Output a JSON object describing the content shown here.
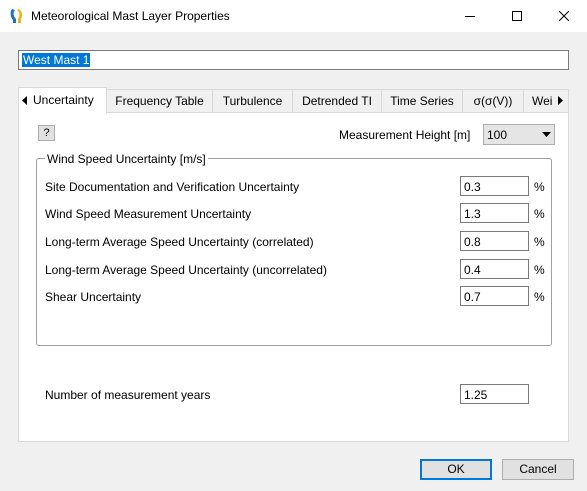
{
  "window": {
    "title": "Meteorological Mast Layer Properties",
    "icon": "wind-turbine-app-icon"
  },
  "name_field": {
    "value": "West Mast 1",
    "selected": true
  },
  "tabs": [
    {
      "label": "Uncertainty",
      "active": true
    },
    {
      "label": "Frequency Table"
    },
    {
      "label": "Turbulence"
    },
    {
      "label": "Detrended TI"
    },
    {
      "label": "Time Series"
    },
    {
      "label": "σ(σ(V))"
    },
    {
      "label": "Wei"
    }
  ],
  "uncertainty": {
    "help_label": "?",
    "measurement_height": {
      "label": "Measurement Height [m]",
      "value": "100"
    },
    "group_title": "Wind Speed Uncertainty [m/s]",
    "rows": [
      {
        "label": "Site Documentation and Verification Uncertainty",
        "value": "0.3",
        "unit": "%"
      },
      {
        "label": "Wind Speed Measurement Uncertainty",
        "value": "1.3",
        "unit": "%"
      },
      {
        "label": "Long-term Average Speed Uncertainty (correlated)",
        "value": "0.8",
        "unit": "%"
      },
      {
        "label": "Long-term Average Speed Uncertainty (uncorrelated)",
        "value": "0.4",
        "unit": "%"
      },
      {
        "label": "Shear Uncertainty",
        "value": "0.7",
        "unit": "%"
      }
    ],
    "years": {
      "label": "Number of measurement years",
      "value": "1.25"
    }
  },
  "buttons": {
    "ok": "OK",
    "cancel": "Cancel"
  },
  "colors": {
    "accent": "#0078d7",
    "panel_bg": "#ffffff",
    "dialog_bg": "#f0f0f0"
  }
}
